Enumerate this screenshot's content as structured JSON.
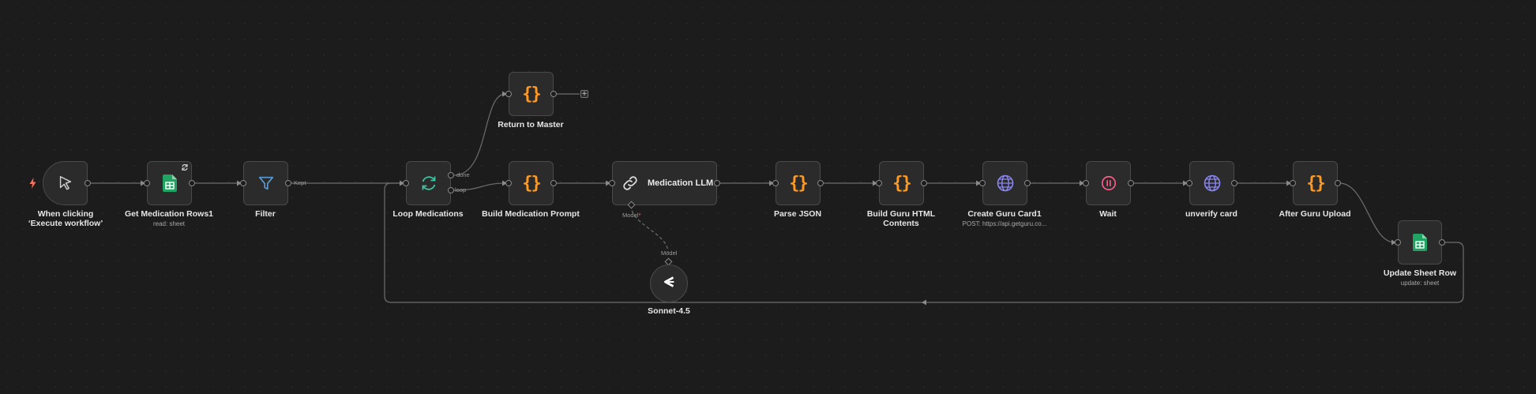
{
  "nodes": {
    "trigger": {
      "label": "When clicking ‘Execute workflow’",
      "icon": "cursor-icon"
    },
    "get_rows": {
      "label": "Get Medication Rows1",
      "subtitle": "read: sheet",
      "icon": "google-sheets-icon"
    },
    "filter": {
      "label": "Filter",
      "icon": "funnel-icon"
    },
    "loop": {
      "label": "Loop Medications",
      "icon": "loop-icon"
    },
    "return_master": {
      "label": "Return to Master",
      "icon": "code-braces-icon"
    },
    "build_prompt": {
      "label": "Build Medication Prompt",
      "icon": "code-braces-icon"
    },
    "medication_llm": {
      "label": "Medication LLM",
      "icon": "chain-link-icon"
    },
    "sonnet": {
      "label": "Sonnet-4.5",
      "icon": "anthropic-icon"
    },
    "parse_json": {
      "label": "Parse JSON",
      "icon": "code-braces-icon"
    },
    "build_guru": {
      "label": "Build Guru HTML Contents",
      "icon": "code-braces-icon"
    },
    "create_guru": {
      "label": "Create Guru Card1",
      "subtitle": "POST: https://api.getguru.co...",
      "icon": "globe-icon"
    },
    "wait": {
      "label": "Wait",
      "icon": "pause-icon"
    },
    "unverify": {
      "label": "unverify card",
      "icon": "globe-icon"
    },
    "after_guru": {
      "label": "After Guru Upload",
      "icon": "code-braces-icon"
    },
    "update_row": {
      "label": "Update Sheet Row",
      "subtitle": "update: sheet",
      "icon": "google-sheets-icon"
    }
  },
  "edge_labels": {
    "kept": "Kept",
    "done": "done",
    "loop": "loop",
    "model_port": "Model",
    "model_required_mark": "*",
    "model_input": "Model"
  },
  "colors": {
    "background": "#1c1c1c",
    "node": "#2b2b2b",
    "code": "#ff9922",
    "sheets": "#1fa463",
    "filter": "#5b9bd5",
    "loop": "#3ec4a0",
    "http": "#8a86f0",
    "wait": "#ff5c8a",
    "trigger_bolt": "#ff6d5a"
  }
}
